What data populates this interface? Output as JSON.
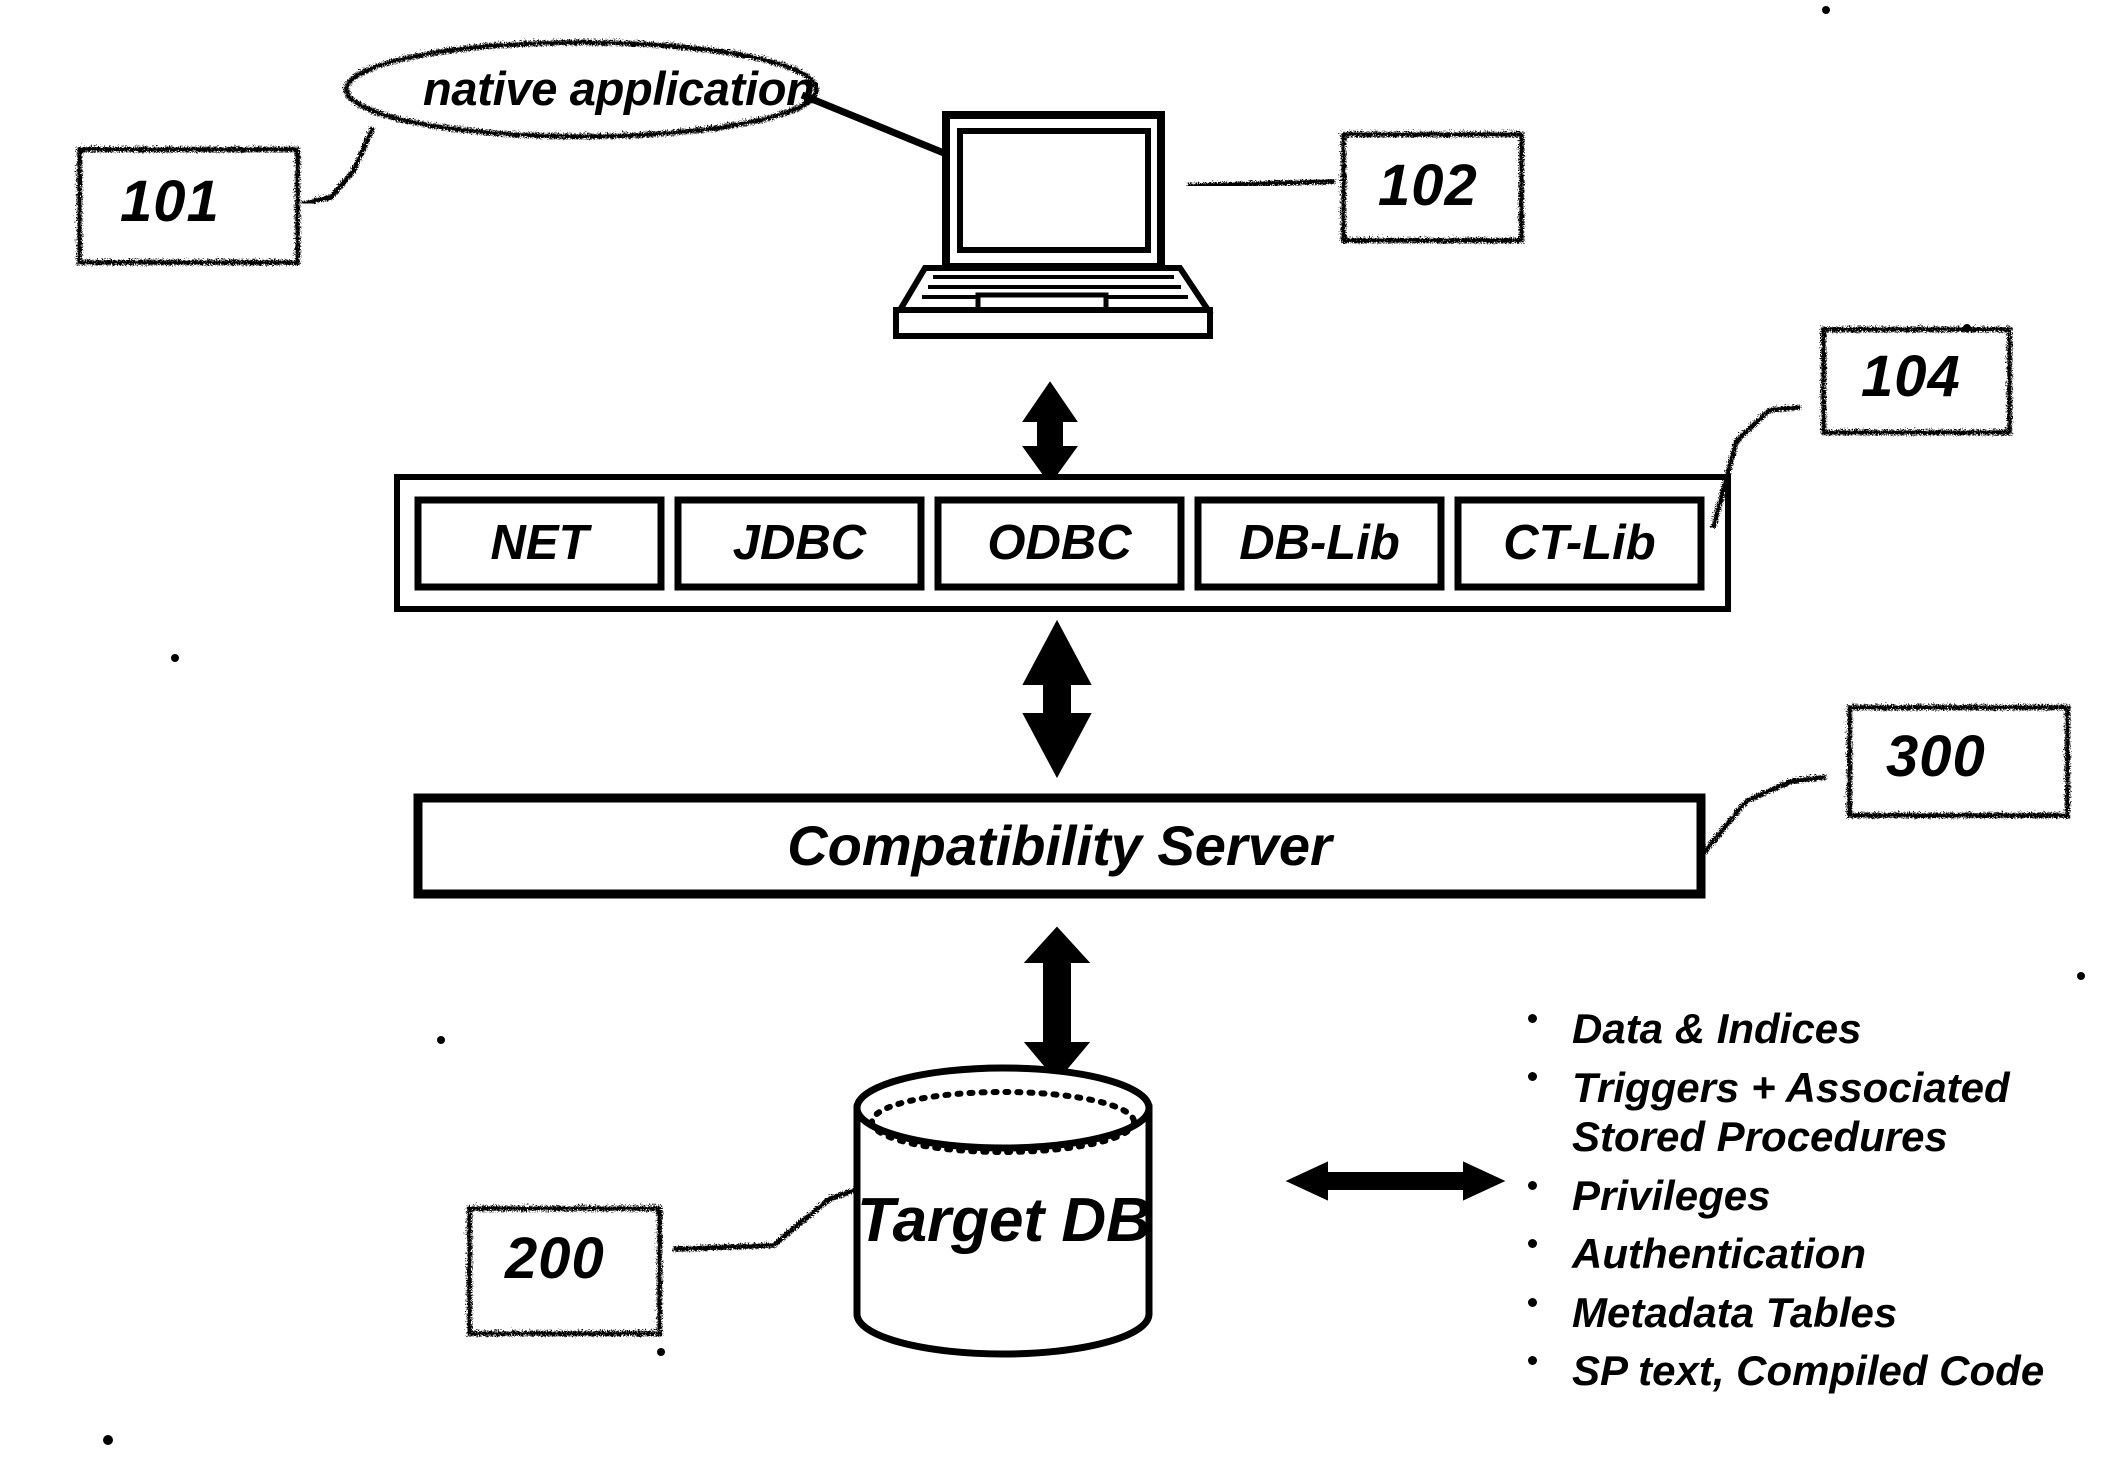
{
  "figure": {
    "type": "patent-diagram",
    "background_color": "#ffffff",
    "ink_color": "#000000"
  },
  "callout": {
    "native_application_label": "native application"
  },
  "reference_numerals": {
    "client_app": "101",
    "client_machine": "102",
    "driver_layer": "104",
    "compatibility_server": "300",
    "target_db": "200"
  },
  "driver_layer": {
    "items": [
      {
        "label": "NET"
      },
      {
        "label": "JDBC"
      },
      {
        "label": "ODBC"
      },
      {
        "label": "DB-Lib"
      },
      {
        "label": "CT-Lib"
      }
    ]
  },
  "compatibility_server": {
    "label": "Compatibility Server"
  },
  "database": {
    "label": "Target DB"
  },
  "db_contents": {
    "items": [
      "Data & Indices",
      "Triggers + Associated\nStored Procedures",
      "Privileges",
      "Authentication",
      "Metadata Tables",
      "SP text, Compiled Code"
    ]
  },
  "connectors": {
    "laptop_to_drivers": "double-headed-vertical-arrow",
    "drivers_to_server": "double-headed-vertical-arrow",
    "server_to_db": "double-headed-vertical-arrow",
    "db_to_contents": "double-headed-horizontal-arrow"
  }
}
